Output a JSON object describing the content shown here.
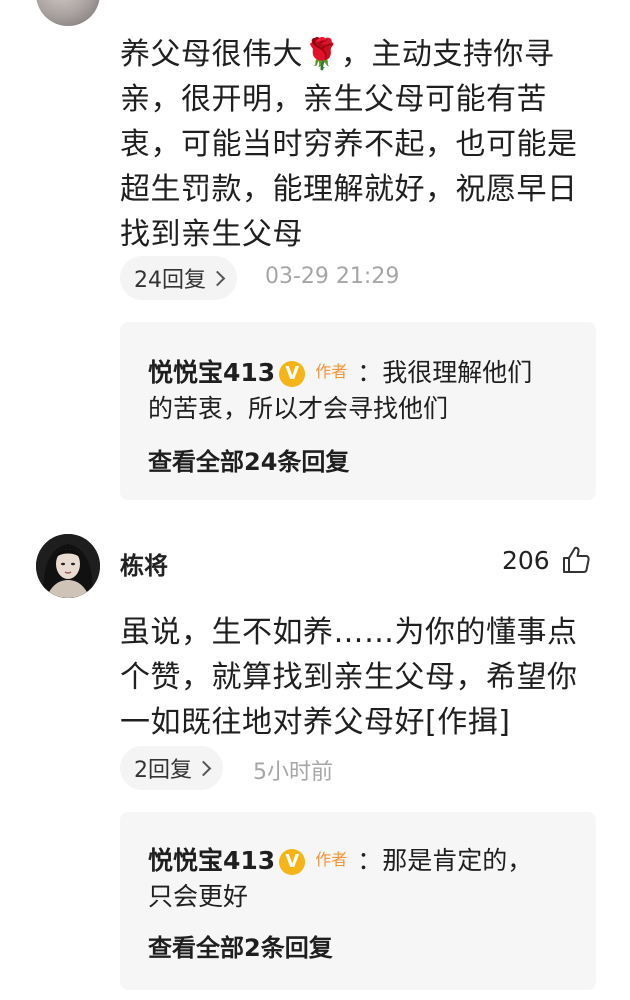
{
  "comments": [
    {
      "author": "",
      "likes": "",
      "text_lines": [
        "养父母很伟大🌹，主动支持你寻",
        "亲，很开明，亲生父母可能有苦",
        "衷，可能当时穷养不起，也可能是",
        "超生罚款，能理解就好，祝愿早日",
        "找到亲生父母"
      ],
      "reply_count_label": "24回复",
      "timestamp": "03-29 21:29",
      "reply_preview": {
        "author": "悦悦宝413",
        "badge": "V",
        "author_tag": "作者",
        "text_first": "：我很理解他们",
        "text_second": "的苦衷，所以才会寻找他们",
        "view_all_label": "查看全部24条回复"
      }
    },
    {
      "author": "栋将",
      "likes": "206",
      "text_lines": [
        "虽说，生不如养……为你的懂事点",
        "个赞，就算找到亲生父母，希望你",
        "一如既往地对养父母好[作揖]"
      ],
      "reply_count_label": "2回复",
      "timestamp": "5小时前",
      "reply_preview": {
        "author": "悦悦宝413",
        "badge": "V",
        "author_tag": "作者",
        "text_first": "：那是肯定的，",
        "text_second": "只会更好",
        "view_all_label": "查看全部2条回复"
      }
    }
  ],
  "icons": {
    "like": "thumbs-up-outline-icon",
    "badge": "verified-v-icon",
    "chevron": "chevron-right-icon"
  },
  "colors": {
    "badge": "#f5b517",
    "author_tag": "#f29436",
    "timestamp": "#a6a6a6",
    "reply_box_bg": "#f6f6f6",
    "pill_bg": "#f4f4f4"
  }
}
